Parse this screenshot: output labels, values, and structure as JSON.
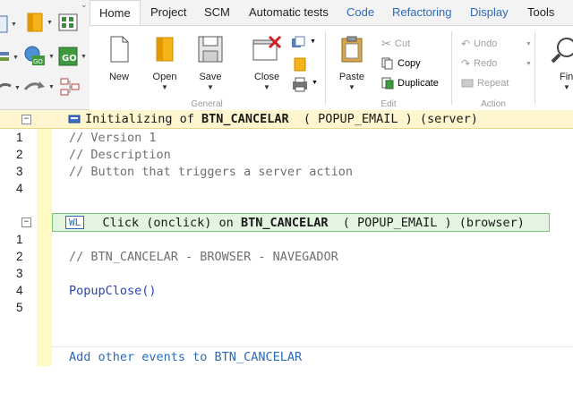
{
  "ribbon": {
    "tabs": [
      {
        "label": "Home",
        "active": true
      },
      {
        "label": "Project"
      },
      {
        "label": "SCM"
      },
      {
        "label": "Automatic tests"
      },
      {
        "label": "Code",
        "color": "#2b6ab8"
      },
      {
        "label": "Refactoring",
        "color": "#2b6ab8"
      },
      {
        "label": "Display",
        "color": "#2b6ab8"
      },
      {
        "label": "Tools"
      }
    ],
    "general": {
      "label": "General",
      "new": "New",
      "open": "Open",
      "save": "Save",
      "close": "Close"
    },
    "edit": {
      "label": "Edit",
      "paste": "Paste",
      "cut": "Cut",
      "copy": "Copy",
      "duplicate": "Duplicate"
    },
    "action": {
      "label": "Action",
      "undo": "Undo",
      "redo": "Redo",
      "repeat": "Repeat"
    },
    "find": "Find"
  },
  "editor": {
    "init_header": {
      "prefix": "Initializing of ",
      "control": "BTN_CANCELAR",
      "window": "  ( POPUP_EMAIL ) (server)"
    },
    "init_lines": [
      {
        "num": "1",
        "text": "// Version 1"
      },
      {
        "num": "2",
        "text": "// Description"
      },
      {
        "num": "3",
        "text": "// Button that triggers a server action"
      },
      {
        "num": "4",
        "text": ""
      }
    ],
    "click_header": {
      "badge": "WL",
      "prefix": "  Click (onclick) on ",
      "control": "BTN_CANCELAR",
      "window": "  ( POPUP_EMAIL ) (browser)"
    },
    "click_lines": [
      {
        "num": "1",
        "text": ""
      },
      {
        "num": "2",
        "text": "// BTN_CANCELAR - BROWSER - NAVEGADOR"
      },
      {
        "num": "3",
        "text": ""
      },
      {
        "num": "4",
        "text": "PopupClose()"
      },
      {
        "num": "5",
        "text": ""
      }
    ],
    "add_events": "Add other events to BTN_CANCELAR",
    "colors": {
      "comment": "#707070",
      "function": "#2846b8",
      "link": "#2b6ab8",
      "init_band": "#fff6cf",
      "click_band": "#e3f5e1",
      "gutter": "#fff9c4"
    }
  }
}
